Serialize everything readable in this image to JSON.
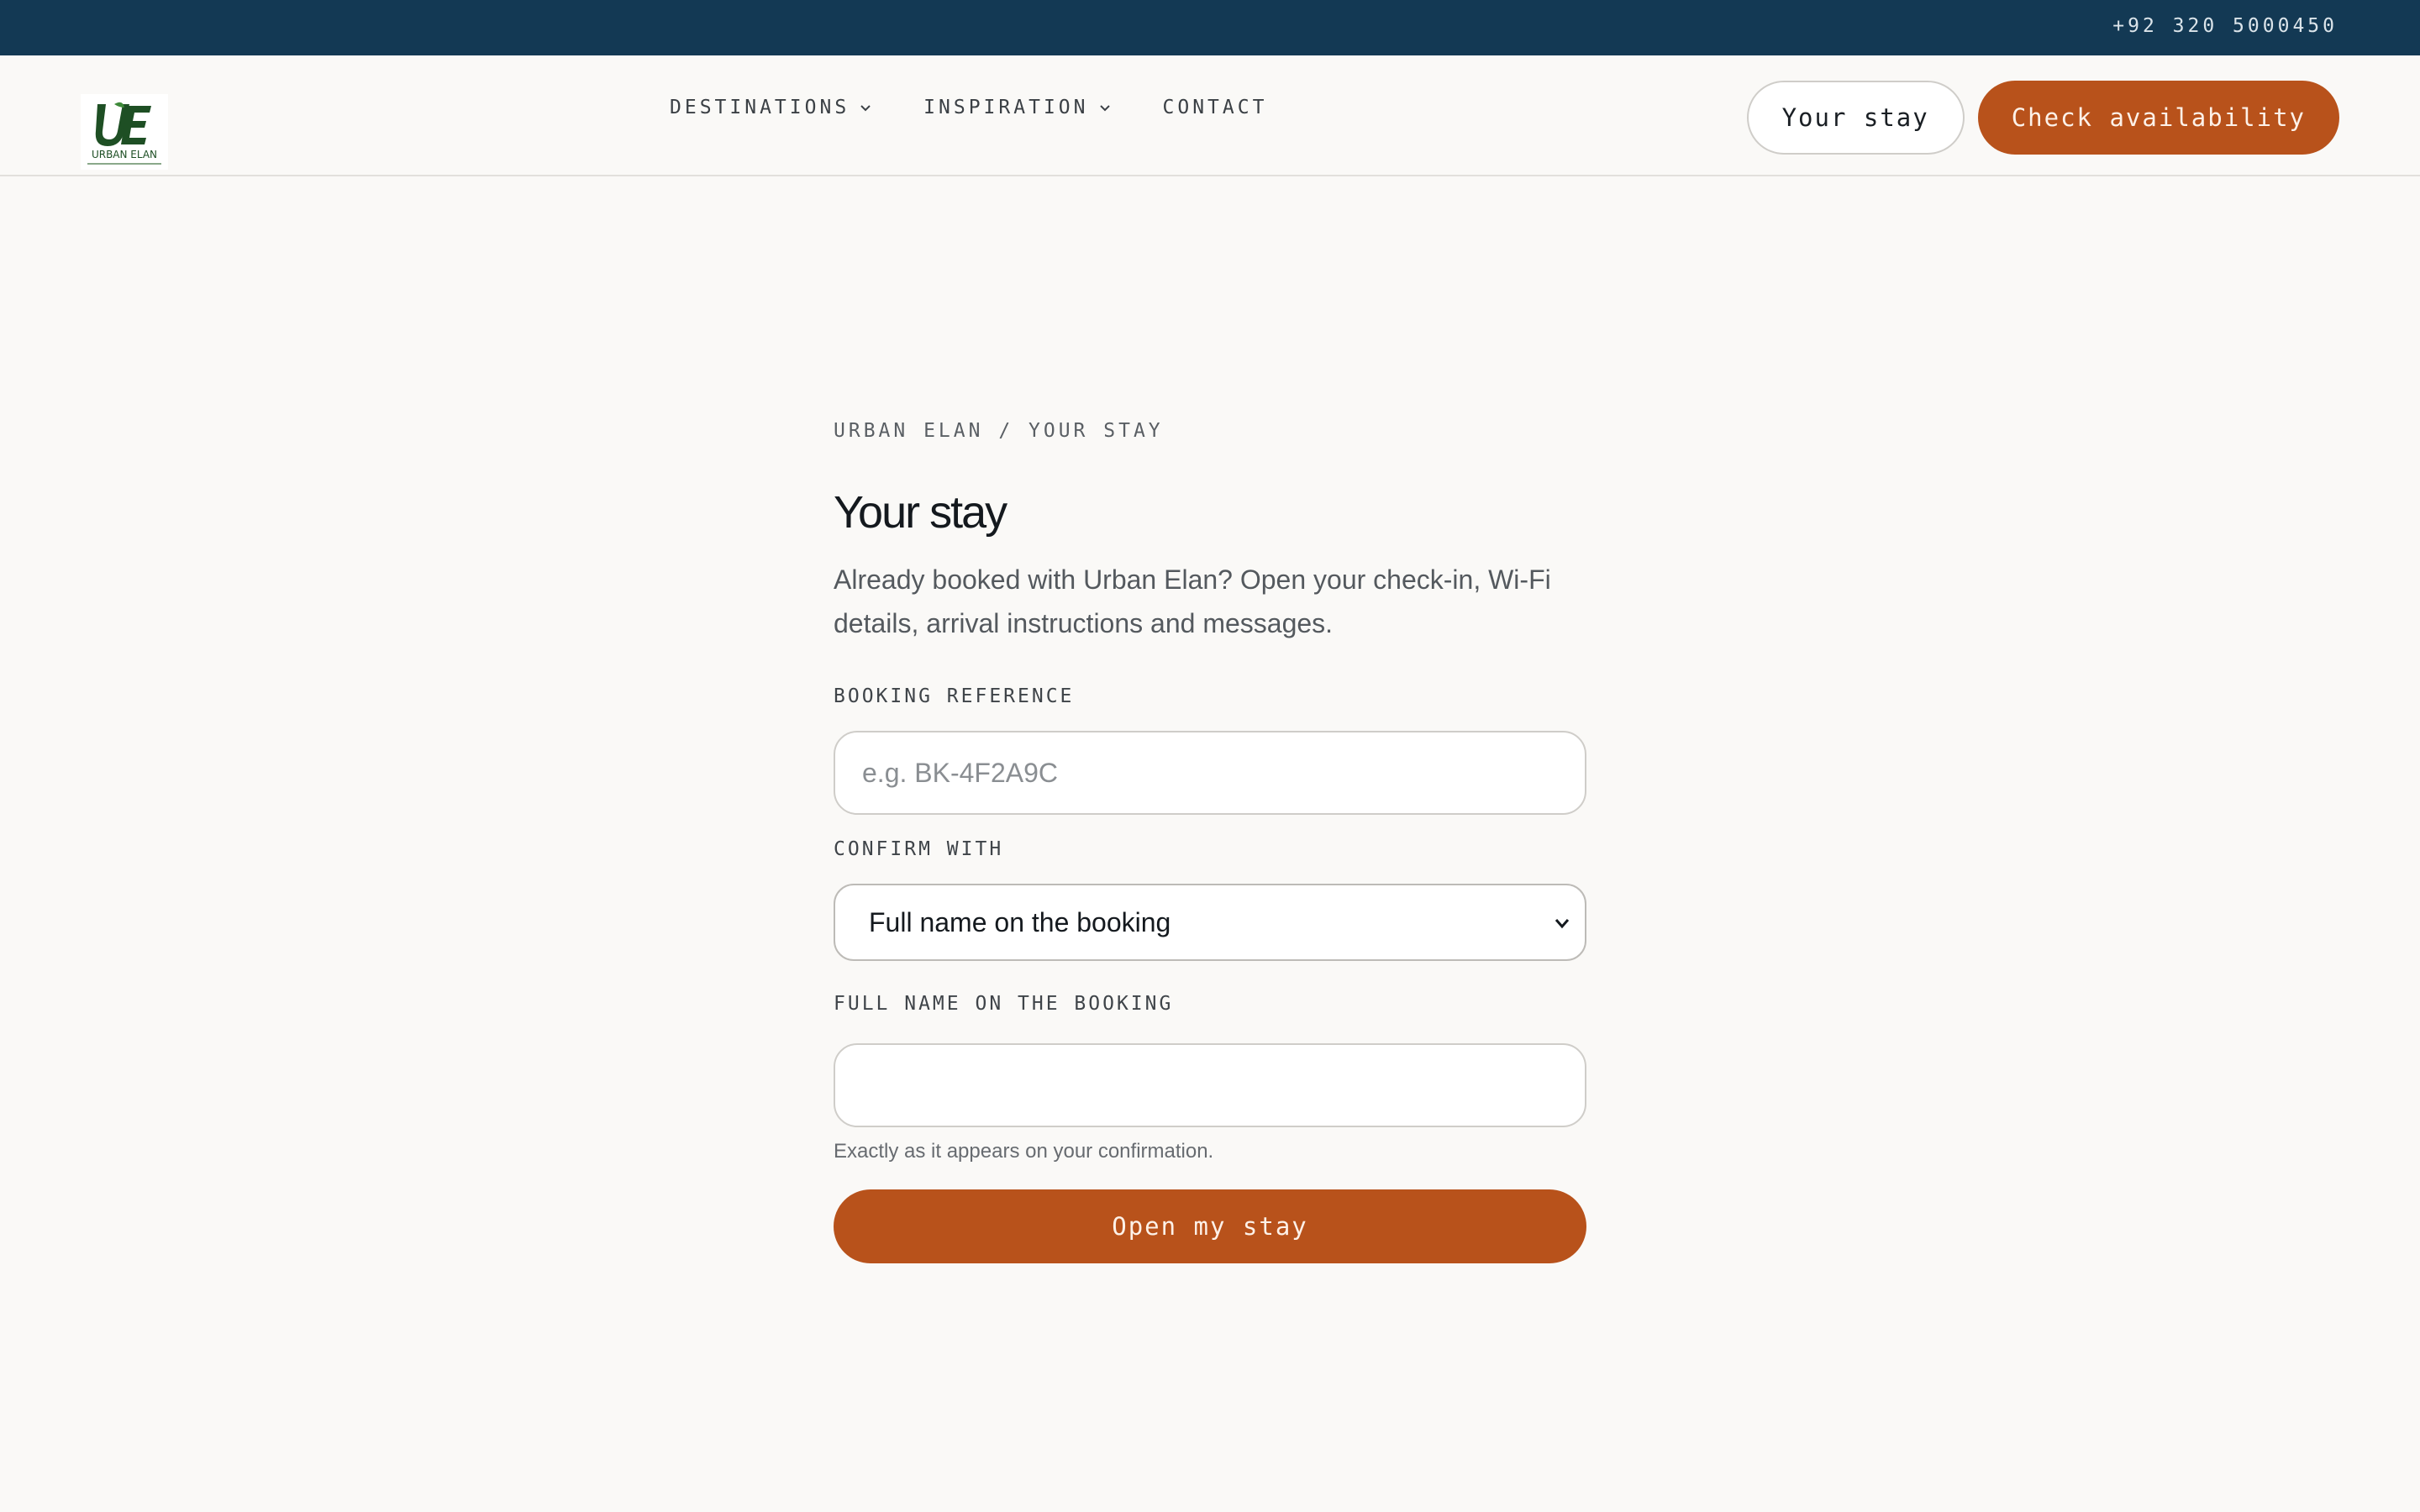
{
  "topbar": {
    "phone": "+92 320 5000450"
  },
  "brand": {
    "logo_text": "URBAN ELAN",
    "logo_mark": "UE",
    "logo_color": "#1e4f24"
  },
  "nav": {
    "items": [
      {
        "label": "DESTINATIONS",
        "has_dropdown": true
      },
      {
        "label": "INSPIRATION",
        "has_dropdown": true
      },
      {
        "label": "CONTACT",
        "has_dropdown": false
      }
    ]
  },
  "header": {
    "your_stay_label": "Your stay",
    "check_availability_label": "Check availability"
  },
  "main": {
    "breadcrumb": "URBAN ELAN / YOUR STAY",
    "title": "Your stay",
    "intro": "Already booked with Urban Elan? Open your check-in, Wi-Fi details, arrival instructions and messages.",
    "booking_reference": {
      "label": "BOOKING REFERENCE",
      "placeholder": "e.g. BK-4F2A9C",
      "value": ""
    },
    "confirm_with": {
      "label": "CONFIRM WITH",
      "selected": "Full name on the booking"
    },
    "full_name": {
      "label": "FULL NAME ON THE BOOKING",
      "value": "",
      "hint": "Exactly as it appears on your confirmation."
    },
    "submit_label": "Open my stay"
  },
  "colors": {
    "topbar_bg": "#133954",
    "accent": "#b8521b",
    "page_bg": "#faf9f7"
  }
}
